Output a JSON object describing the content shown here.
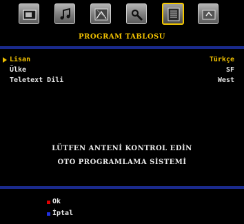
{
  "menu": {
    "title": "PROGRAM TABLOSU",
    "tabs": [
      {
        "icon": "picture-icon"
      },
      {
        "icon": "sound-icon"
      },
      {
        "icon": "feature-icon"
      },
      {
        "icon": "install-icon"
      },
      {
        "icon": "program-table-icon",
        "active": true
      },
      {
        "icon": "source-icon"
      }
    ],
    "rows": [
      {
        "label": "Lisan",
        "value": "Türkçe",
        "selected": true
      },
      {
        "label": "Ülke",
        "value": "SF",
        "selected": false
      },
      {
        "label": "Teletext Dili",
        "value": "West",
        "selected": false
      }
    ]
  },
  "message": {
    "line1": "LÜTFEN ANTENİ KONTROL EDİN",
    "line2": "OTO PROGRAMLAMA SİSTEMİ"
  },
  "legend": {
    "ok_label": "Ok",
    "cancel_label": "İptal"
  },
  "colors": {
    "accent": "#f0c000",
    "separator": "#1a2a8c",
    "ok_dot": "#e00000",
    "cancel_dot": "#2030e0"
  }
}
